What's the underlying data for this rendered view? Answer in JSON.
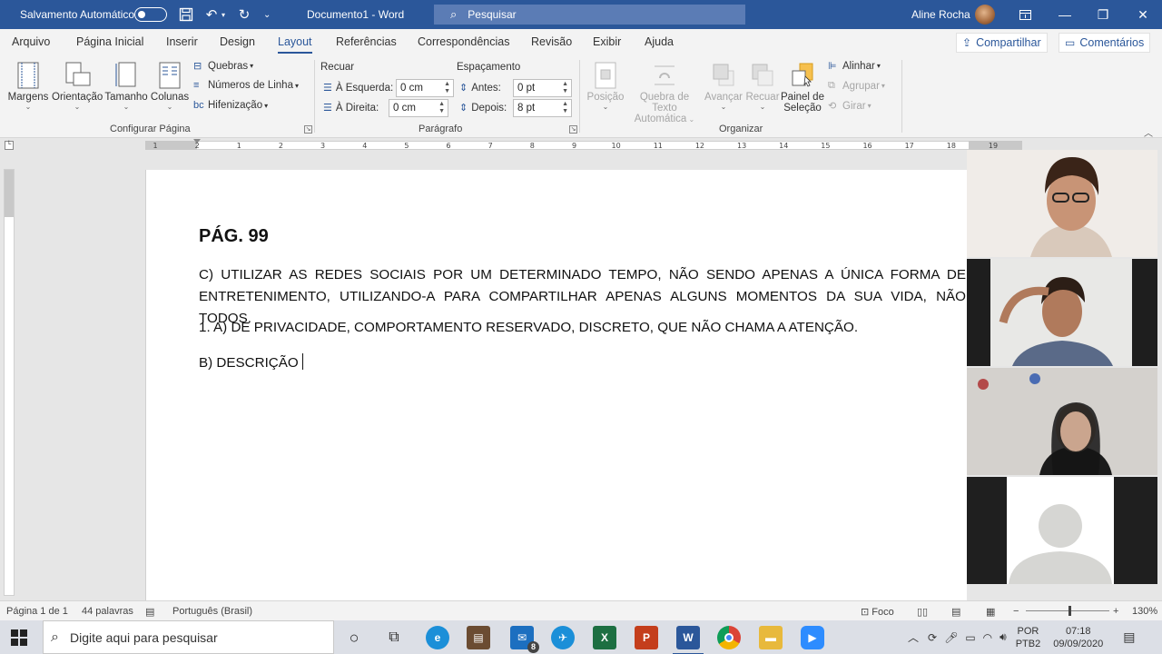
{
  "titlebar": {
    "autosave_label": "Salvamento Automático",
    "doc_title": "Documento1  -  Word",
    "search_placeholder": "Pesquisar",
    "user_name": "Aline Rocha"
  },
  "tabs": [
    "Arquivo",
    "Página Inicial",
    "Inserir",
    "Design",
    "Layout",
    "Referências",
    "Correspondências",
    "Revisão",
    "Exibir",
    "Ajuda"
  ],
  "share": {
    "share_label": "Compartilhar",
    "comments_label": "Comentários"
  },
  "ribbon": {
    "page_setup": {
      "margins": "Margens",
      "orientation": "Orientação",
      "size": "Tamanho",
      "columns": "Colunas",
      "breaks": "Quebras",
      "line_numbers": "Números de Linha",
      "hyphenation": "Hifenização",
      "group_label": "Configurar Página"
    },
    "paragraph": {
      "indent_title": "Recuar",
      "left_label": "À Esquerda:",
      "left_value": "0 cm",
      "right_label": "À Direita:",
      "right_value": "0 cm",
      "spacing_title": "Espaçamento",
      "before_label": "Antes:",
      "before_value": "0 pt",
      "after_label": "Depois:",
      "after_value": "8 pt",
      "group_label": "Parágrafo"
    },
    "arrange": {
      "position": "Posição",
      "wrap_1": "Quebra de Texto",
      "wrap_2": "Automática",
      "bring_forward": "Avançar",
      "send_backward": "Recuar",
      "selection_pane_1": "Painel de",
      "selection_pane_2": "Seleção",
      "align": "Alinhar",
      "group": "Agrupar",
      "rotate": "Girar",
      "group_label": "Organizar"
    }
  },
  "ruler_ticks": [
    "1",
    "2",
    "1",
    "2",
    "3",
    "4",
    "5",
    "6",
    "7",
    "8",
    "9",
    "10",
    "11",
    "12",
    "13",
    "14",
    "15",
    "16",
    "17",
    "18",
    "19"
  ],
  "document": {
    "heading": "PÁG. 99",
    "para1": "C) UTILIZAR AS REDES SOCIAIS POR UM DETERMINADO TEMPO, NÃO SENDO APENAS A ÚNICA FORMA DE ENTRETENIMENTO, UTILIZANDO-A PARA COMPARTILHAR APENAS ALGUNS MOMENTOS DA SUA VIDA, NÃO TODOS.",
    "para2": "1. A) DE PRIVACIDADE, COMPORTAMENTO RESERVADO, DISCRETO, QUE NÃO CHAMA A ATENÇÃO.",
    "para3": "B) DESCRIÇÃO"
  },
  "status_bar": {
    "page": "Página 1 de 1",
    "words": "44 palavras",
    "language": "Português (Brasil)",
    "focus": "Foco",
    "zoom": "130%"
  },
  "taskbar": {
    "search_placeholder": "Digite aqui para pesquisar",
    "mail_badge": "8",
    "lang_1": "POR",
    "lang_2": "PTB2",
    "time": "07:18",
    "date": "09/09/2020"
  }
}
